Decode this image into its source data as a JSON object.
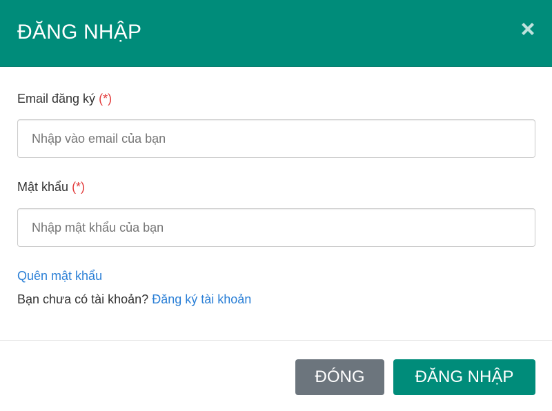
{
  "header": {
    "title": "ĐĂNG NHẬP",
    "close_icon": "close-icon"
  },
  "form": {
    "email": {
      "label": "Email đăng ký",
      "required_mark": "(*)",
      "placeholder": "Nhập vào email của bạn",
      "value": ""
    },
    "password": {
      "label": "Mật khẩu",
      "required_mark": "(*)",
      "placeholder": "Nhập mật khẩu của bạn",
      "value": ""
    }
  },
  "links": {
    "forgot_password": "Quên mật khẩu",
    "no_account_text": "Bạn chưa có tài khoản?",
    "register": "Đăng ký tài khoản"
  },
  "footer": {
    "close_label": "ĐÓNG",
    "login_label": "ĐĂNG NHẬP"
  },
  "colors": {
    "brand": "#008c7a",
    "secondary": "#6c757d",
    "link": "#2a7fd6",
    "required": "#e23b3b"
  }
}
